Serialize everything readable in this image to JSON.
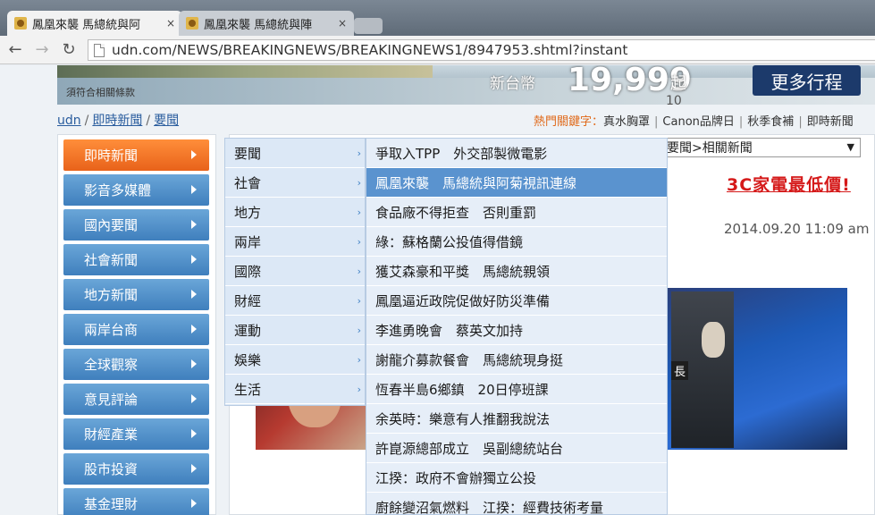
{
  "browser": {
    "tabs": [
      {
        "title": "鳳凰來襲 馬總統與阿",
        "active": true
      },
      {
        "title": "鳳凰來襲 馬總統與陣",
        "active": false
      }
    ],
    "address": "udn.com/NEWS/BREAKINGNEWS/BREAKINGNEWS1/8947953.shtml?instant",
    "close_glyph": "×",
    "back_glyph": "←",
    "forward_glyph": "→",
    "reload_glyph": "↻"
  },
  "banner": {
    "note": "須符合相關條款",
    "price_label": "新台幣",
    "price": "19,999",
    "price_suffix": "起",
    "cta": "更多行程"
  },
  "breadcrumb": {
    "items": [
      "udn",
      "即時新聞",
      "要聞"
    ],
    "separator": "/"
  },
  "hot_keywords": {
    "label": "熱門關鍵字：",
    "items": [
      "真水胸罩",
      "Canon品牌日",
      "秋季食補",
      "即時新聞"
    ],
    "separator": "|"
  },
  "left_nav": {
    "items": [
      "即時新聞",
      "影音多媒體",
      "國內要聞",
      "社會新聞",
      "地方新聞",
      "兩岸台商",
      "全球觀察",
      "意見評論",
      "財經產業",
      "股市投資",
      "基金理財"
    ],
    "active_index": 0
  },
  "content": {
    "date_fragment": "10",
    "related_select": "要聞>相關新聞",
    "promo": "3C家電最低價!",
    "timestamp": "2014.09.20 11:09 am",
    "photo_label": "長"
  },
  "menu": {
    "categories": [
      "要聞",
      "社會",
      "地方",
      "兩岸",
      "國際",
      "財經",
      "運動",
      "娛樂",
      "生活"
    ],
    "headlines": [
      "爭取入TPP　外交部製微電影",
      "鳳凰來襲　馬總統與阿菊視訊連線",
      "食品廠不得拒查　否則重罰",
      "綠：蘇格蘭公投值得借鏡",
      "獲艾森豪和平獎　馬總統親領",
      "鳳凰逼近政院促做好防災準備",
      "李進勇晚會　蔡英文加持",
      "謝龍介募款餐會　馬總統現身挺",
      "恆春半島6鄉鎮　20日停班課",
      "余英時：樂意有人推翻我說法",
      "許崑源總部成立　吳副總統站台",
      "江揆：政府不會辦獨立公投",
      "廚餘變沼氣燃料　江揆：經費技術考量"
    ],
    "highlight_index": 1,
    "chevron": "›"
  }
}
